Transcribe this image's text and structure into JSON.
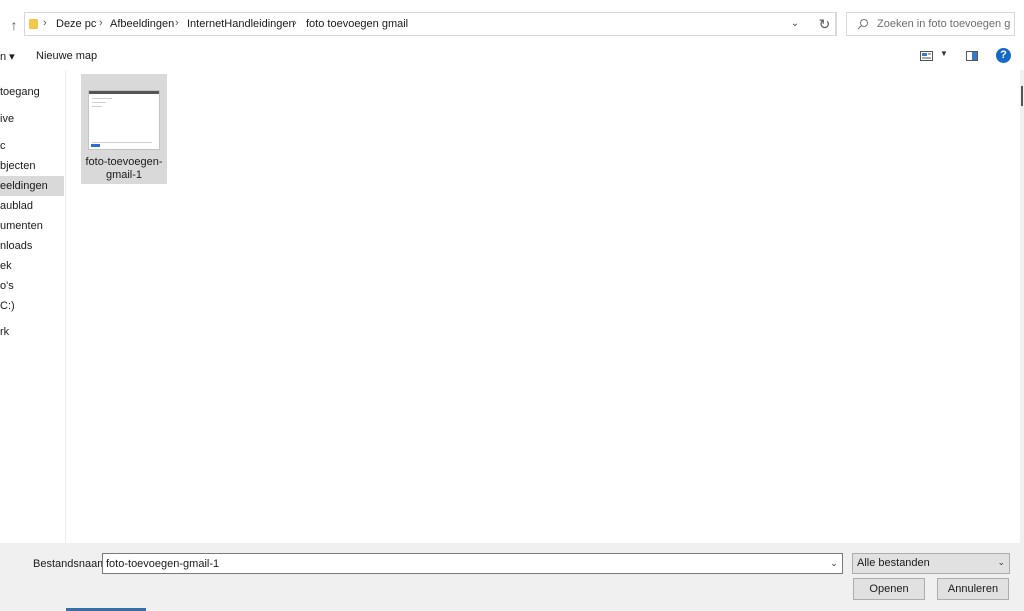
{
  "address": {
    "breadcrumbs": [
      "Deze pc",
      "Afbeeldingen",
      "InternetHandleidingen",
      "foto toevoegen gmail"
    ]
  },
  "search": {
    "placeholder": "Zoeken in foto toevoegen g..."
  },
  "toolbar": {
    "organize_label": "n ▾",
    "new_folder_label": "Nieuwe map",
    "help_label": "?"
  },
  "nav": {
    "items": [
      {
        "label": "toegang",
        "selected": false
      },
      {
        "label": "ive",
        "selected": false
      },
      {
        "label": "c",
        "selected": false
      },
      {
        "label": "bjecten",
        "selected": false
      },
      {
        "label": "eeldingen",
        "selected": true
      },
      {
        "label": "aublad",
        "selected": false
      },
      {
        "label": "umenten",
        "selected": false
      },
      {
        "label": "nloads",
        "selected": false
      },
      {
        "label": "ek",
        "selected": false
      },
      {
        "label": "o's",
        "selected": false
      },
      {
        "label": "C:)",
        "selected": false
      },
      {
        "label": "rk",
        "selected": false
      }
    ]
  },
  "content": {
    "files": [
      {
        "name": "foto-toevoegen-gmail-1"
      }
    ]
  },
  "footer": {
    "filename_label": "Bestandsnaam:",
    "filename_value": "foto-toevoegen-gmail-1",
    "filetype_value": "Alle bestanden",
    "open_label": "Openen",
    "cancel_label": "Annuleren"
  },
  "colors": {
    "selection": "#d9d9d9",
    "help_blue": "#1569c7",
    "folder_yellow": "#f2c84b",
    "panel_gray": "#f0f0f0"
  }
}
